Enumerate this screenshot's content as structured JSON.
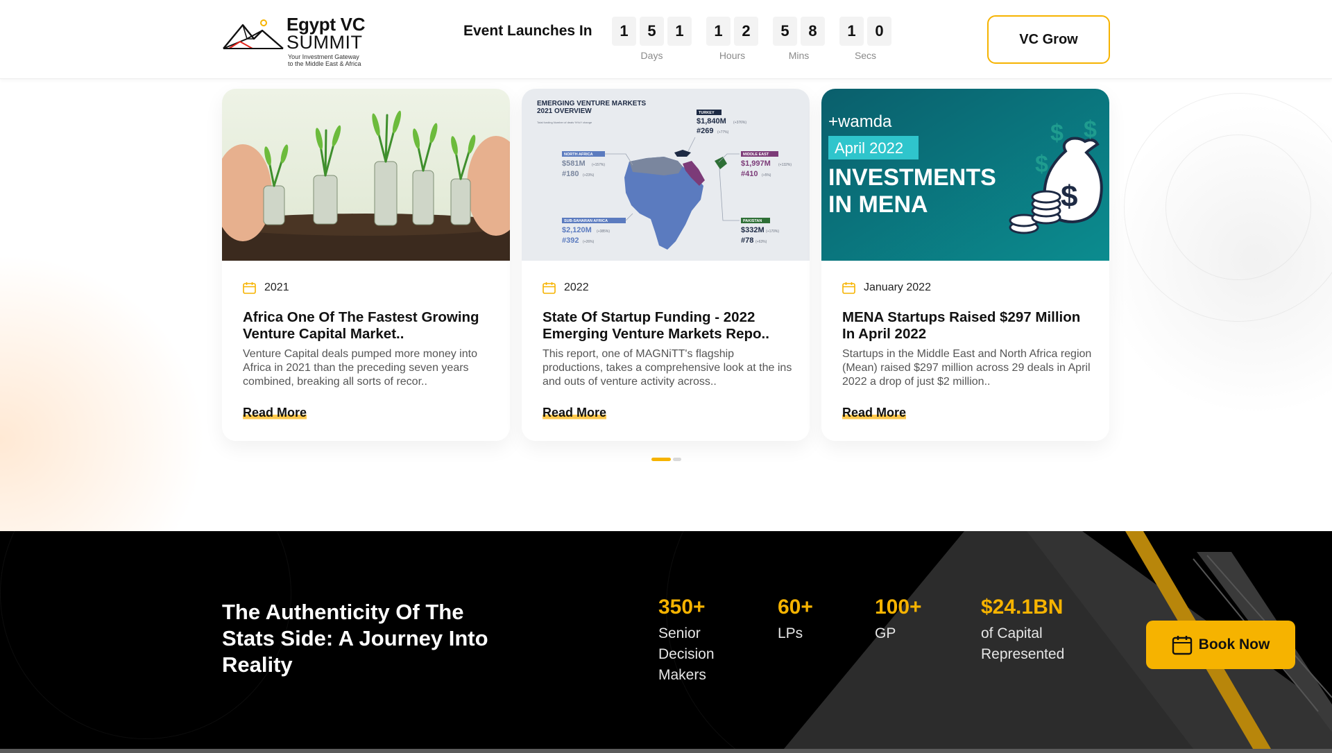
{
  "header": {
    "logo": {
      "title_line1": "Egypt VC",
      "title_line2": "SUMMIT",
      "tagline_line1": "Your Investment Gateway",
      "tagline_line2": "to the Middle East & Africa"
    },
    "countdown": {
      "label": "Event Launches In",
      "days": [
        "1",
        "5",
        "1"
      ],
      "hours": [
        "1",
        "2"
      ],
      "mins": [
        "5",
        "8"
      ],
      "secs": [
        "1",
        "0"
      ],
      "units": {
        "days": "Days",
        "hours": "Hours",
        "mins": "Mins",
        "secs": "Secs"
      }
    },
    "cta_label": "VC Grow"
  },
  "articles": [
    {
      "date": "2021",
      "title": "Africa One Of The Fastest Growing Venture Capital Market..",
      "excerpt": "Venture Capital deals pumped more money into Africa in 2021 than the preceding seven years combined, breaking all sorts of recor..",
      "read_more": "Read More",
      "image": "money-plants"
    },
    {
      "date": "2022",
      "title": "State Of Startup Funding - 2022 Emerging Venture Markets Repo..",
      "excerpt": "This report, one of MAGNiTT's flagship productions, takes a comprehensive look at the ins and outs of venture activity across..",
      "read_more": "Read More",
      "image": "emerging-markets-map",
      "image_text": {
        "heading1": "EMERGING VENTURE MARKETS",
        "heading2": "2021 OVERVIEW",
        "legend": "Total funding    Number of deals    %YoY change",
        "turkey": {
          "label": "TURKEY",
          "value": "$1,840M",
          "value_change": "(+376%)",
          "deals": "#269",
          "deals_change": "(+77%)"
        },
        "north_africa": {
          "label": "NORTH AFRICA",
          "value": "$581M",
          "value_change": "(+157%)",
          "deals": "#180",
          "deals_change": "(+23%)"
        },
        "middle_east": {
          "label": "MIDDLE EAST",
          "value": "$1,997M",
          "value_change": "(+132%)",
          "deals": "#410",
          "deals_change": "(+5%)"
        },
        "sub_saharan": {
          "label": "SUB-SAHARAN AFRICA",
          "value": "$2,120M",
          "value_change": "(+385%)",
          "deals": "#392",
          "deals_change": "(+26%)"
        },
        "pakistan": {
          "label": "PAKISTAN",
          "value": "$332M",
          "value_change": "(+170%)",
          "deals": "#78",
          "deals_change": "(+63%)"
        }
      }
    },
    {
      "date": "January 2022",
      "title": "MENA Startups Raised $297 Million In April 2022",
      "excerpt": "Startups in the Middle East and North Africa region (Mean) raised $297 million across 29 deals in April 2022 a drop of just $2 million..",
      "read_more": "Read More",
      "image": "wamda-investments",
      "image_text": {
        "brand": "+wamda",
        "badge": "April 2022",
        "headline1": "INVESTMENTS",
        "headline2": "IN MENA"
      }
    }
  ],
  "carousel": {
    "active_index": 0,
    "page_count": 2
  },
  "stats": {
    "headline": "The Authenticity Of The Stats Side: A Journey Into Reality",
    "items": [
      {
        "value": "350+",
        "label": "Senior Decision Makers"
      },
      {
        "value": "60+",
        "label": "LPs"
      },
      {
        "value": "100+",
        "label": "GP"
      },
      {
        "value": "$24.1BN",
        "label": "of Capital Represented"
      }
    ],
    "cta_label": "Book Now"
  },
  "colors": {
    "accent": "#f6b300",
    "highlight": "#ffc94d",
    "dark": "#000000",
    "teal": "#0b7d88"
  }
}
